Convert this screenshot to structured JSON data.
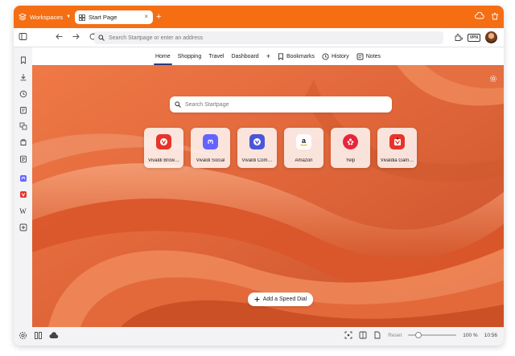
{
  "titlebar": {
    "workspaces_label": "Workspaces",
    "tab_title": "Start Page",
    "accent": "#f56e14"
  },
  "address": {
    "placeholder": "Search Startpage or enter an address",
    "vpn_label": "VPN"
  },
  "page_tabs": [
    {
      "label": "Home",
      "active": true
    },
    {
      "label": "Shopping"
    },
    {
      "label": "Travel"
    },
    {
      "label": "Dashboard"
    },
    {
      "label": "+"
    },
    {
      "label": "Bookmarks",
      "icon": "bookmark-icon"
    },
    {
      "label": "History",
      "icon": "history-icon"
    },
    {
      "label": "Notes",
      "icon": "notes-icon"
    }
  ],
  "search": {
    "placeholder": "Search Startpage"
  },
  "speed_dials": [
    {
      "label": "Vivaldi Brow…",
      "color": "#e8332a",
      "icon": "vivaldi-icon"
    },
    {
      "label": "Vivaldi Social",
      "color": "#6364ff",
      "icon": "mastodon-icon"
    },
    {
      "label": "Vivaldi Com…",
      "color": "#4a56d8",
      "icon": "vivaldi-community-icon"
    },
    {
      "label": "Amazon",
      "color": "#ffffff",
      "icon": "amazon-icon"
    },
    {
      "label": "Yelp",
      "color": "#e8253a",
      "icon": "yelp-icon"
    },
    {
      "label": "Vivaldia Gam…",
      "color": "#e8332a",
      "icon": "vivaldia-game-icon"
    }
  ],
  "add_speed_dial": "Add a Speed Dial",
  "status": {
    "reset_label": "Reset",
    "zoom": "100 %",
    "zoom_fraction": 0.2,
    "time": "10:56"
  },
  "sidebar_icons": [
    "bookmarks-icon",
    "downloads-icon",
    "history-icon",
    "notes-icon",
    "translate-icon",
    "reading-list-icon",
    "mail-icon",
    "mastodon-panel-icon",
    "vivaldi-panel-icon",
    "wikipedia-icon",
    "add-panel-icon"
  ]
}
